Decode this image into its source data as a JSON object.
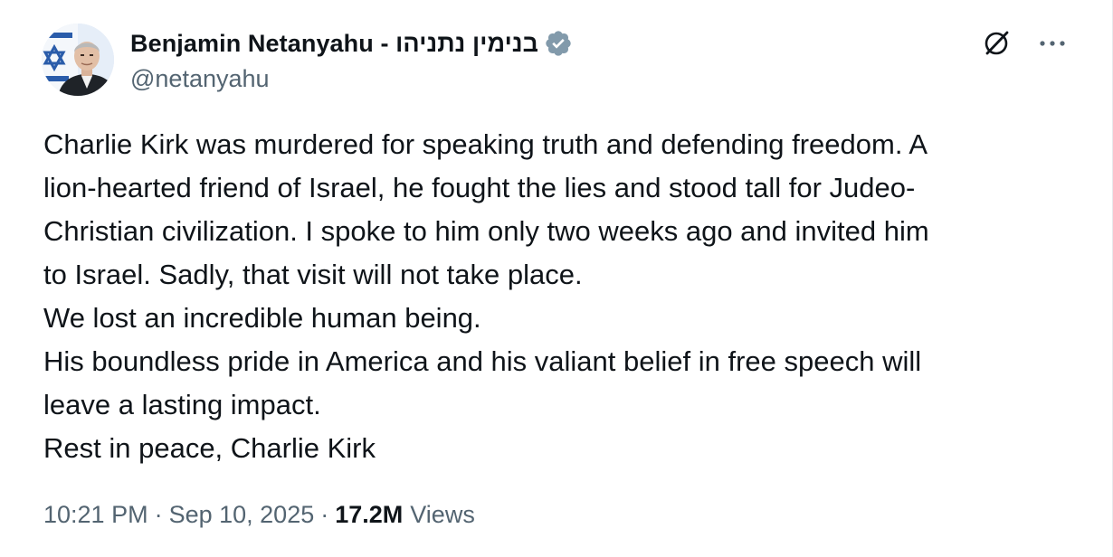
{
  "author": {
    "display_name": "Benjamin Netanyahu - בנימין נתניהו",
    "handle": "@netanyahu",
    "verified_color": "#829aab"
  },
  "actions": {
    "grok_icon": "grok-slash-icon",
    "more_icon": "more-options-icon"
  },
  "tweet": {
    "lines": [
      "Charlie Kirk was murdered for speaking truth and defending freedom. A",
      "lion-hearted friend of Israel, he fought the lies and stood tall for Judeo-",
      "Christian civilization. I spoke to him only two weeks ago and invited him",
      "to Israel. Sadly, that visit will not take place.",
      "We lost an incredible human being.",
      "His boundless pride in America and his valiant belief in free speech will",
      "leave a lasting impact.",
      "Rest in peace, Charlie Kirk"
    ]
  },
  "meta": {
    "time": "10:21 PM",
    "separator": "·",
    "date": "Sep 10, 2025",
    "views_count": "17.2M",
    "views_label": "Views"
  }
}
